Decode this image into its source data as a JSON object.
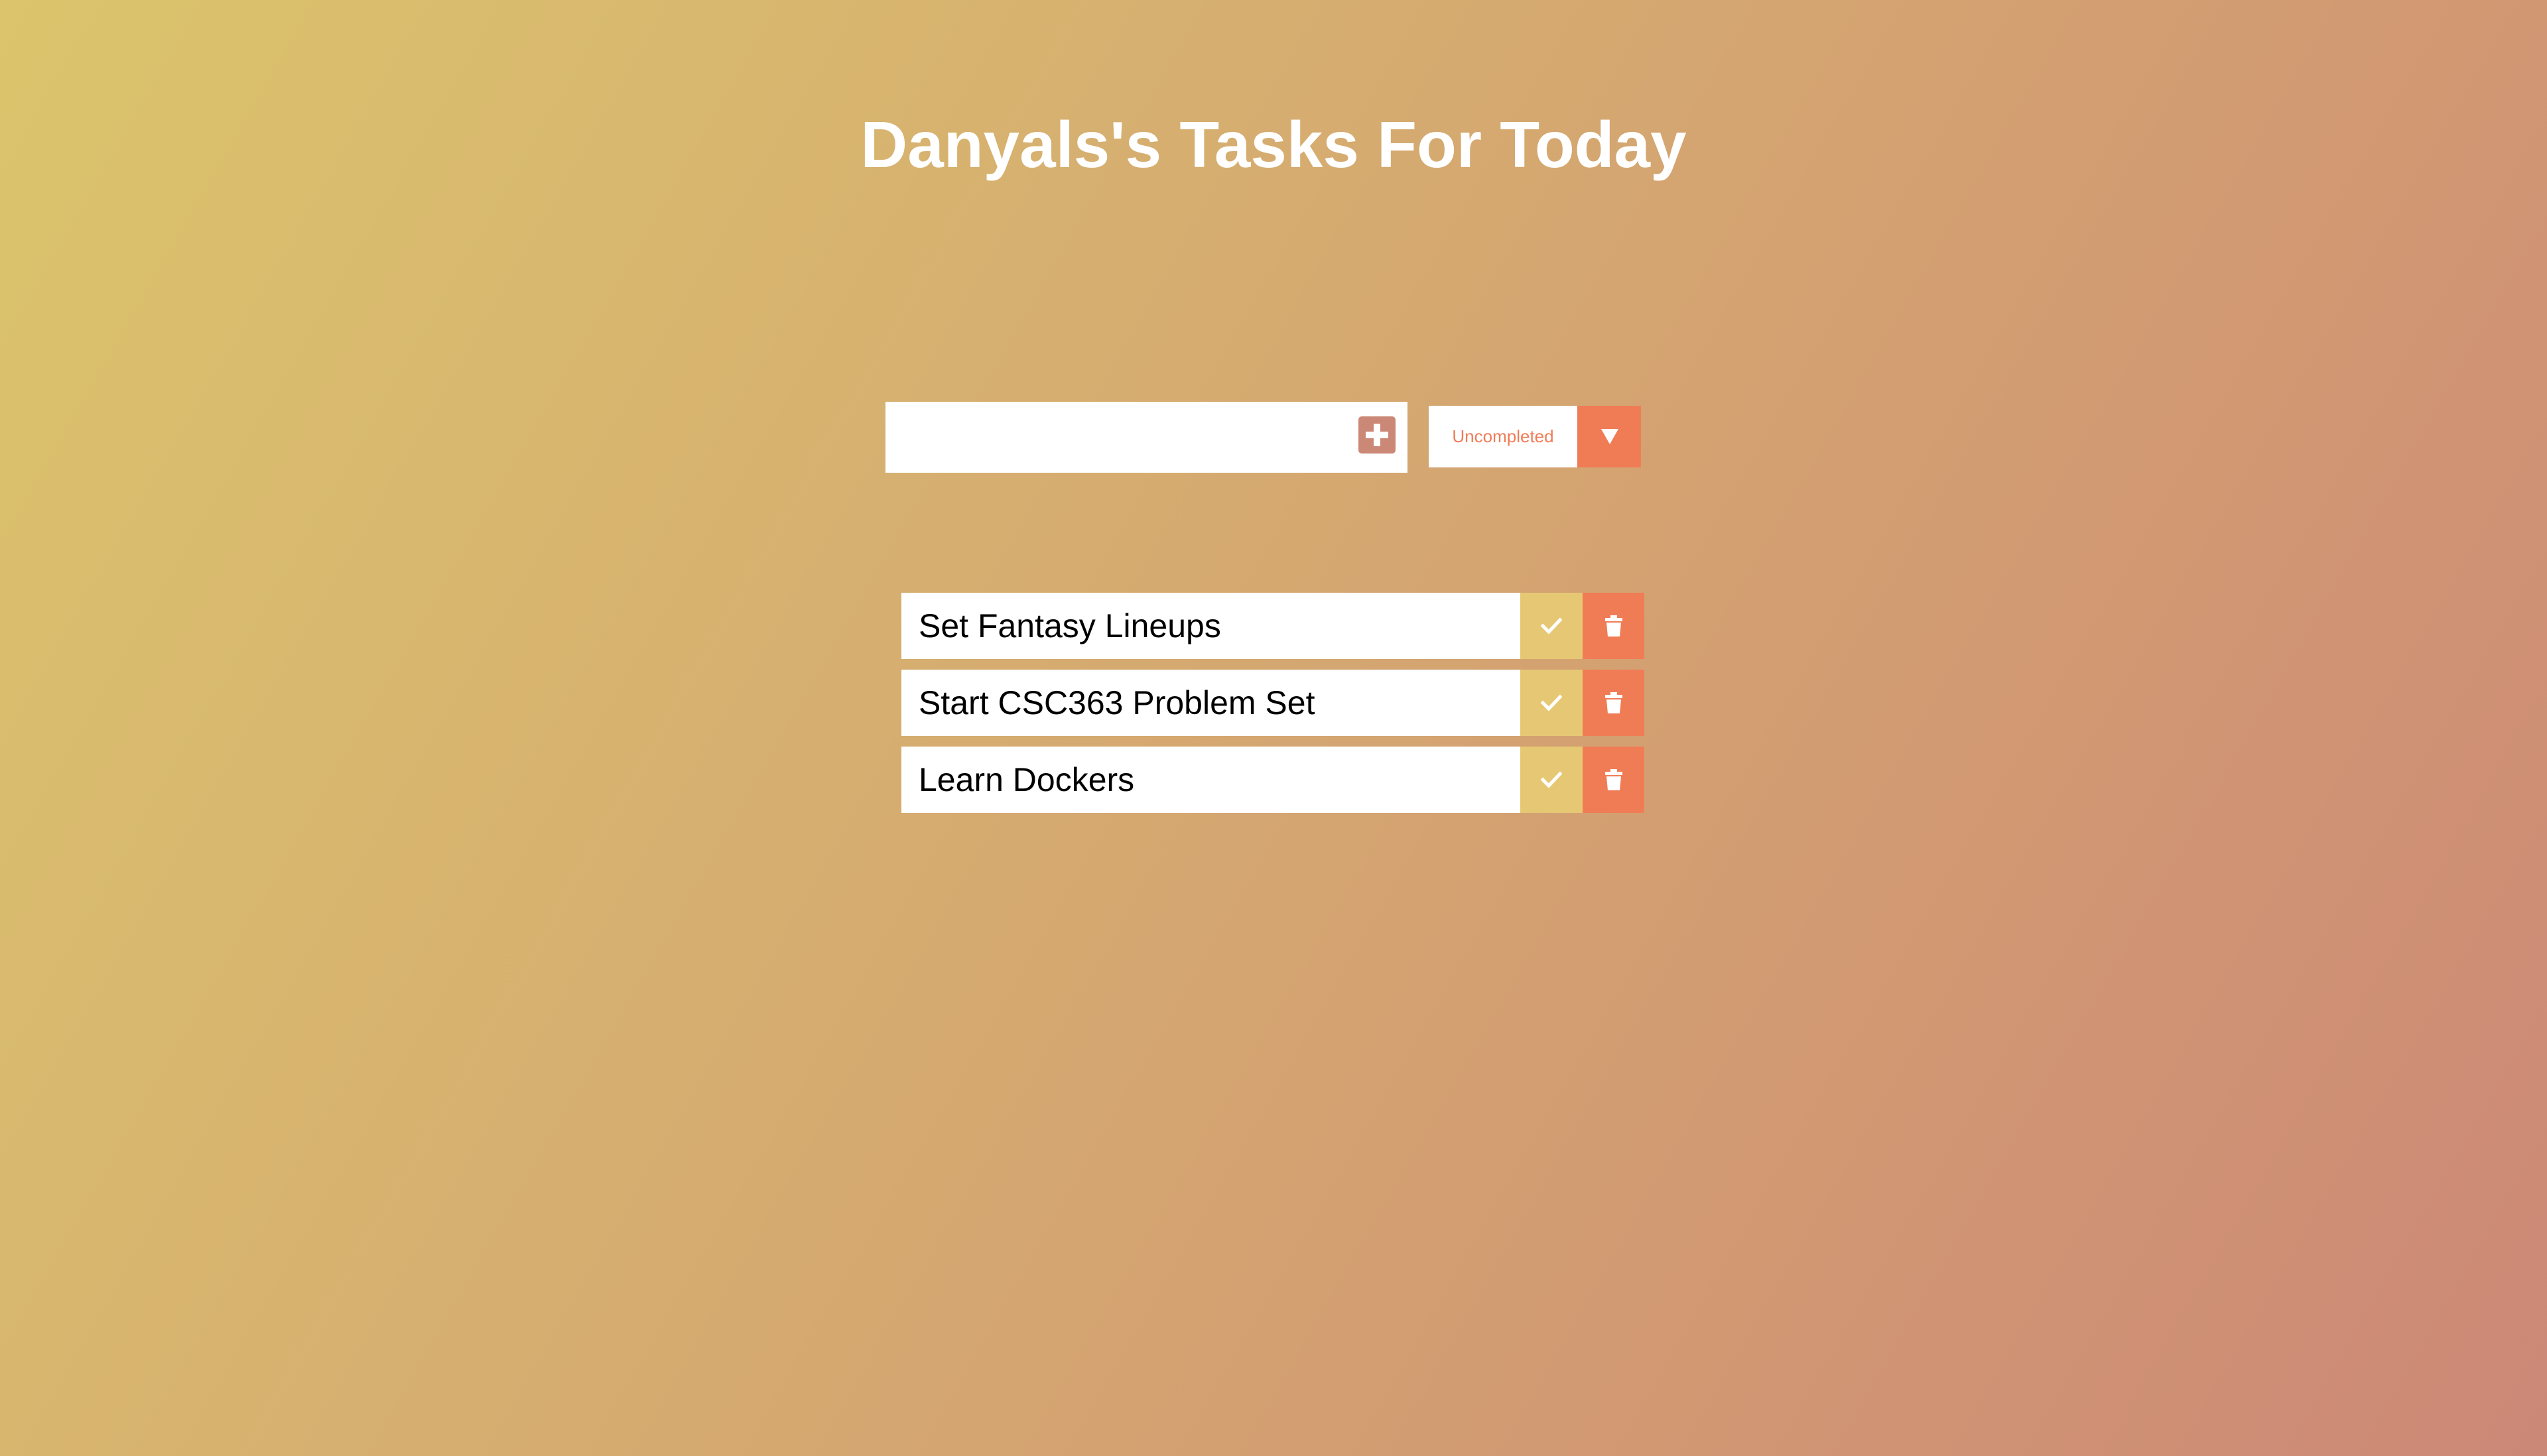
{
  "header": {
    "title": "Danyals's Tasks For Today"
  },
  "form": {
    "input_value": "",
    "input_placeholder": "",
    "add_icon": "plus-square-icon",
    "filter": {
      "selected": "Uncompleted",
      "arrow_icon": "caret-down-icon"
    }
  },
  "todos": [
    {
      "text": "Set Fantasy Lineups",
      "complete_icon": "check-icon",
      "delete_icon": "trash-icon"
    },
    {
      "text": "Start CSC363 Problem Set",
      "complete_icon": "check-icon",
      "delete_icon": "trash-icon"
    },
    {
      "text": "Learn Dockers",
      "complete_icon": "check-icon",
      "delete_icon": "trash-icon"
    }
  ],
  "colors": {
    "gradient_start": "#dbc46c",
    "gradient_end": "#cc8877",
    "accent": "#f07c56",
    "complete": "#e6c874",
    "add_button": "#cc8877",
    "title": "#ffffff"
  }
}
